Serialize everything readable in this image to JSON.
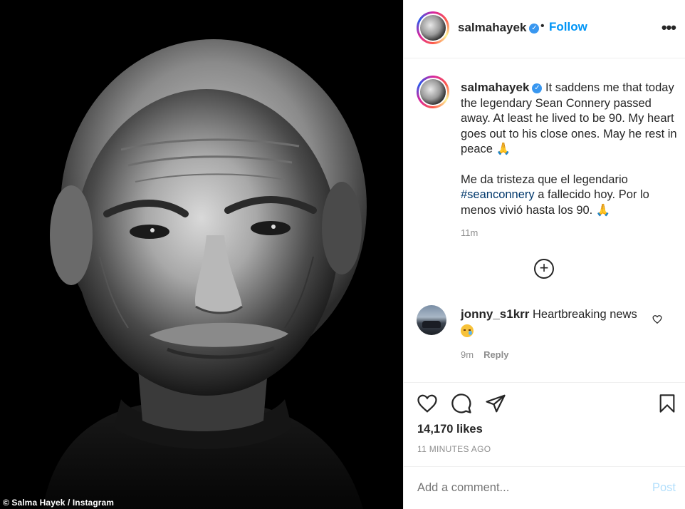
{
  "photo": {
    "credit": "© Salma Hayek / Instagram"
  },
  "header": {
    "username": "salmahayek",
    "verified_glyph": "✓",
    "separator": "•",
    "follow_label": "Follow",
    "more_label": "•••"
  },
  "caption": {
    "username": "salmahayek",
    "text_en": "It saddens me that today the legendary Sean Connery passed away. At least he lived to be 90. My heart goes out to his close ones. May he rest in peace",
    "text_es_before": "Me da tristeza que el legendario",
    "hashtag": "#seanconnery",
    "text_es_after": "a fallecido hoy. Por lo menos vivió hasta los 90.",
    "time": "11m"
  },
  "load_more": {
    "label": "+"
  },
  "comment": {
    "username": "jonny_s1krr",
    "text": "Heartbreaking news",
    "time": "9m",
    "reply_label": "Reply"
  },
  "actions": {
    "likes": "14,170 likes",
    "timestamp": "11 MINUTES AGO"
  },
  "add_comment": {
    "placeholder": "Add a comment...",
    "post_label": "Post"
  },
  "colors": {
    "accent": "#0095f6",
    "post_disabled": "#b2dffc",
    "muted": "#8e8e8e",
    "text": "#262626",
    "verified": "#3897f0"
  }
}
